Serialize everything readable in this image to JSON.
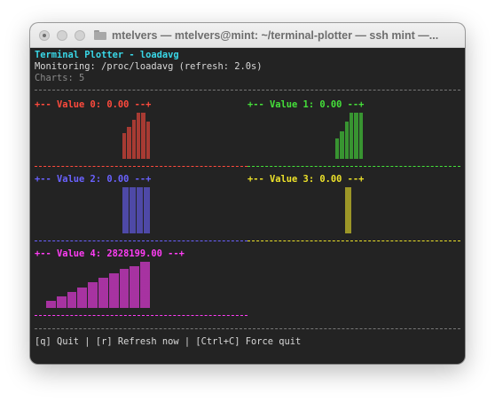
{
  "window": {
    "title": "mtelvers — mtelvers@mint: ~/terminal-plotter — ssh mint —..."
  },
  "terminal": {
    "header_title": "Terminal Plotter - loadavg",
    "monitoring": "Monitoring: /proc/loadavg (refresh: 2.0s)",
    "charts_count": "Charts: 5",
    "separator": "------------------------------------------------------------------------",
    "footer": "[q] Quit | [r] Refresh now | [Ctrl+C] Force quit"
  },
  "panels": [
    {
      "title": "+-- Value 0: 0.00 --+",
      "color": "#ff4a3d",
      "levels": [
        0.55,
        0.7,
        0.85,
        1.0,
        1.0,
        0.8
      ]
    },
    {
      "title": "+-- Value 1: 0.00 --+",
      "color": "#45e03a",
      "levels": [
        0.45,
        0.6,
        0.8,
        1.0,
        1.0,
        1.0
      ]
    },
    {
      "title": "+-- Value 2: 0.00 --+",
      "color": "#6a62ff",
      "levels": [
        1.0,
        1.0,
        1.0,
        1.0
      ]
    },
    {
      "title": "+-- Value 3: 0.00 --+",
      "color": "#ede22a",
      "levels": [
        1.0
      ]
    },
    {
      "title": "+-- Value 4: 2828199.00 --+",
      "color": "#ff3df5",
      "levels": [
        0.15,
        0.25,
        0.35,
        0.45,
        0.55,
        0.65,
        0.75,
        0.85,
        0.9,
        1.0
      ]
    }
  ],
  "colors": {
    "background": "#232323",
    "header": "#39d8e8"
  }
}
